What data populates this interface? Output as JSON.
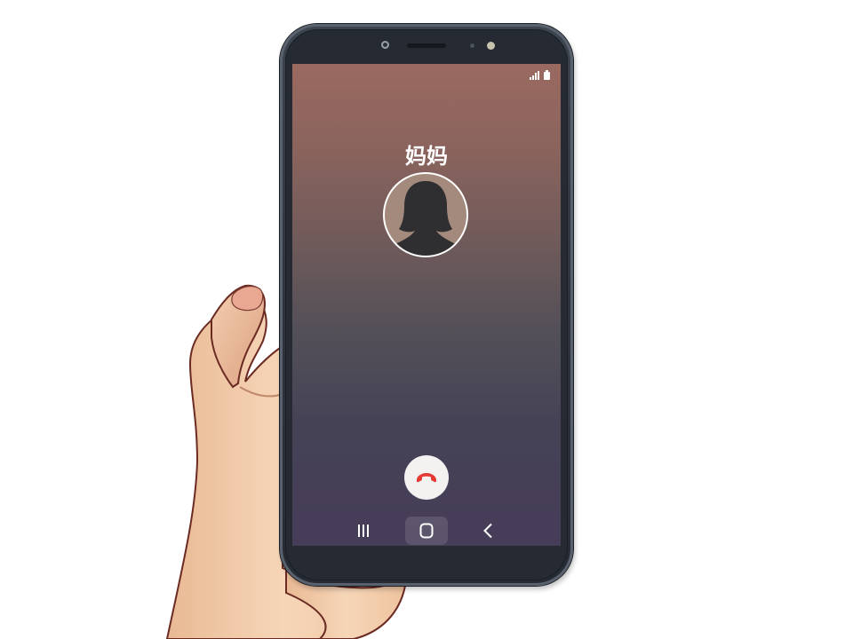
{
  "status_bar": {
    "signal_icon": "signal-bars-icon",
    "battery_icon": "battery-icon"
  },
  "call": {
    "caller_name": "妈妈",
    "avatar_icon": "person-silhouette-icon",
    "end_call_icon": "end-call-icon",
    "end_call_color": "#e53935"
  },
  "nav_bar": {
    "recents_icon": "recent-apps-icon",
    "home_icon": "home-icon",
    "back_icon": "back-chevron-icon"
  },
  "colors": {
    "screen_top": "#9a6a60",
    "screen_bottom": "#463d58",
    "phone_body": "#2e343d"
  }
}
